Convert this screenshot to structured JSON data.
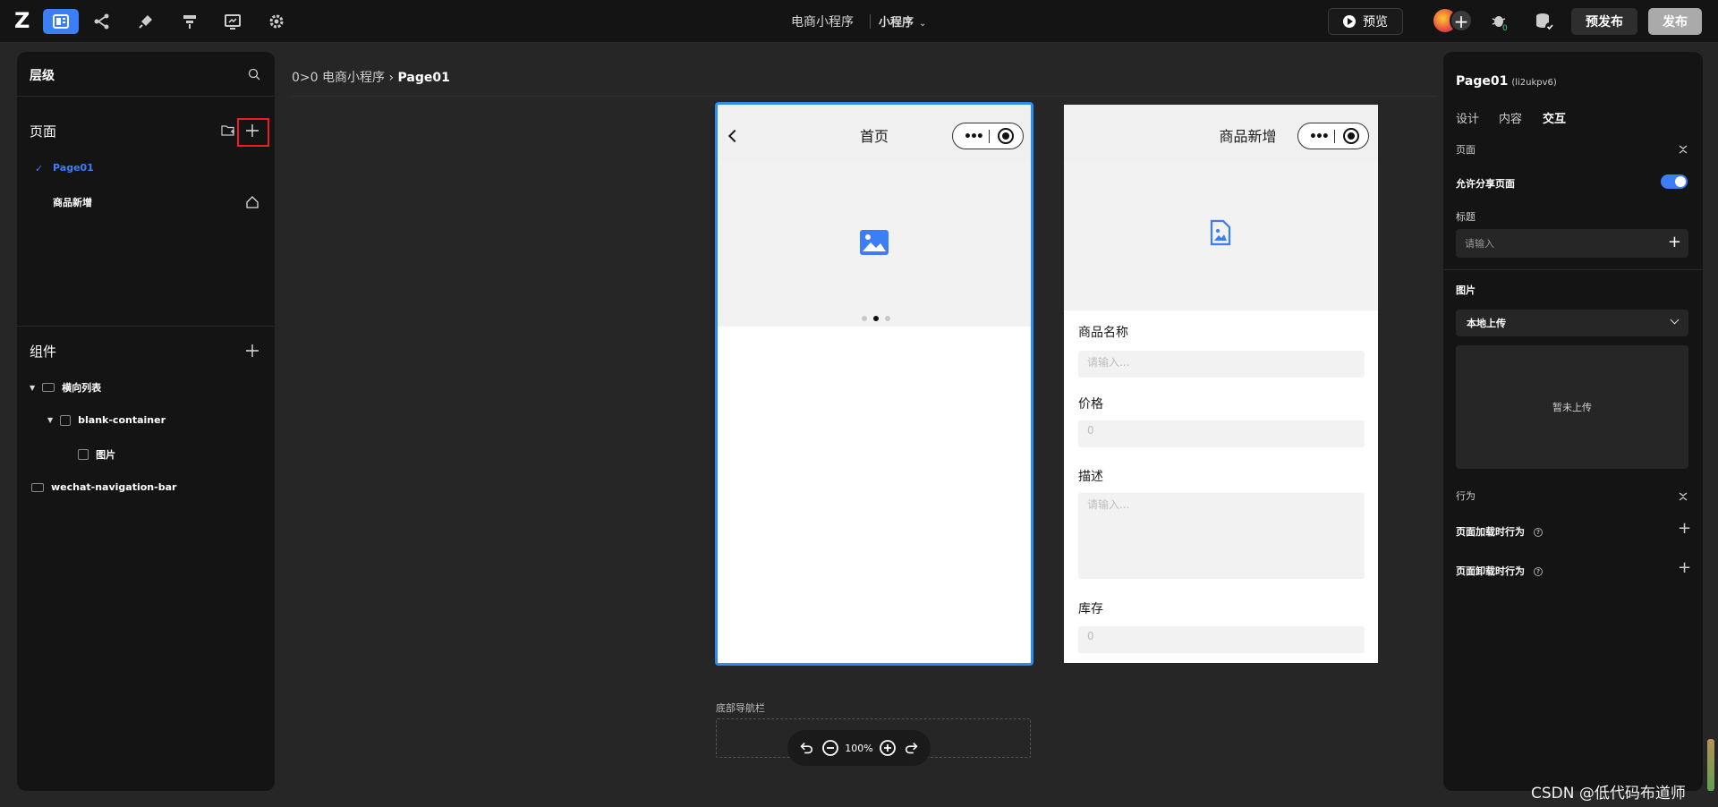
{
  "topbar": {
    "logo": "Z",
    "app_title": "电商小程序",
    "platform": "小程序",
    "preview_label": "预览",
    "prepublish_label": "预发布",
    "publish_label": "发布",
    "icons": [
      "layout-icon",
      "flow-icon",
      "plugin-icon",
      "data-icon",
      "dashboard-icon",
      "settings-icon"
    ]
  },
  "left_panel": {
    "title": "层级",
    "pages_section": "页面",
    "pages": [
      {
        "label": "Page01",
        "active": true
      },
      {
        "label": "商品新增",
        "active": false
      }
    ],
    "components_section": "组件",
    "tree": [
      {
        "label": "横向列表",
        "level": 0
      },
      {
        "label": "blank-container",
        "level": 1
      },
      {
        "label": "图片",
        "level": 2
      },
      {
        "label": "wechat-navigation-bar",
        "level": 0
      }
    ]
  },
  "canvas": {
    "breadcrumb_root": "电商小程序",
    "breadcrumb_sep": "›",
    "breadcrumb_current": "Page01",
    "phone1": {
      "nav_title": "首页"
    },
    "phone2": {
      "nav_title": "商品新增",
      "fields": [
        {
          "label": "商品名称",
          "placeholder": "请输入..."
        },
        {
          "label": "价格",
          "placeholder": "0"
        },
        {
          "label": "描述",
          "placeholder": "请输入..."
        },
        {
          "label": "库存",
          "placeholder": "0"
        }
      ]
    },
    "tabbar_label": "底部导航栏",
    "zoom": "100%"
  },
  "right_panel": {
    "page_name": "Page01",
    "page_id": "(li2ukpv6)",
    "tabs": [
      "设计",
      "内容",
      "交互"
    ],
    "active_tab": "交互",
    "page_section": "页面",
    "share_label": "允许分享页面",
    "title_label": "标题",
    "title_placeholder": "请输入",
    "image_label": "图片",
    "upload_option": "本地上传",
    "upload_empty": "暂未上传",
    "behavior_section": "行为",
    "on_load": "页面加载时行为",
    "on_unload": "页面卸载时行为"
  },
  "watermark": "CSDN @低代码布道师",
  "colors": {
    "accent": "#3c7ef6",
    "selection": "#2d8cf0",
    "highlight": "#ee1c25"
  }
}
